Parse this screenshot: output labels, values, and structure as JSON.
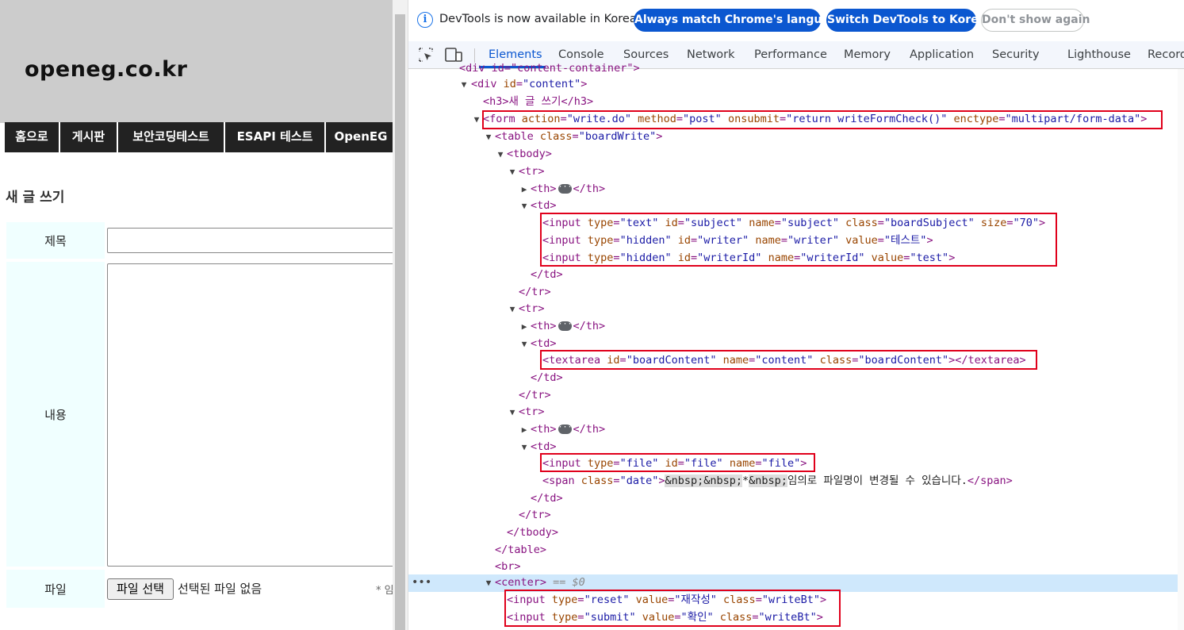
{
  "page": {
    "site_title": "openeg.co.kr",
    "nav": [
      "홈으로",
      "게시판",
      "보안코딩테스트",
      "ESAPI 테스트",
      "OpenEG"
    ],
    "heading": "새 글 쓰기",
    "labels": {
      "subject": "제목",
      "content": "내용",
      "file": "파일"
    },
    "file_button": "파일 선택",
    "no_file": "선택된 파일 없음",
    "date_note": "* 임"
  },
  "devtools": {
    "info_text": "DevTools is now available in Korean!",
    "btn_match": "Always match Chrome's language",
    "btn_korean": "Switch DevTools to Korean",
    "btn_dismiss": "Don't show again",
    "tabs": [
      "Elements",
      "Console",
      "Sources",
      "Network",
      "Performance",
      "Memory",
      "Application",
      "Security",
      "Lighthouse",
      "Record"
    ],
    "active_tab": "Elements",
    "selected_suffix": "== $0",
    "tree": {
      "l0": "<div id=\"content-container\">",
      "l1_tag": "<div ",
      "l1_an": "id",
      "l1_av": "\"content\"",
      "h3": "<h3>새 글 쓰기</h3>",
      "form_tag": "form ",
      "form_action": "action",
      "form_action_v": "\"write.do\"",
      "form_method": "method",
      "form_method_v": "\"post\"",
      "form_onsubmit": "onsubmit",
      "form_onsubmit_v": "\"return writeFormCheck()\"",
      "form_enctype": "enctype",
      "form_enctype_v": "\"multipart/form-data\"",
      "table_open": "<table ",
      "table_an": "class",
      "table_av": "\"boardWrite\"",
      "tbody": "<tbody>",
      "tr": "<tr>",
      "th_open": "<th>",
      "th_close": "</th>",
      "td": "<td>",
      "td_close": "</td>",
      "tr_close": "</tr>",
      "tbody_close": "</tbody>",
      "table_close": "</table>",
      "br": "<br>",
      "center": "<center>",
      "input1": {
        "type": "\"text\"",
        "id": "\"subject\"",
        "name": "\"subject\"",
        "class": "\"boardSubject\"",
        "size": "\"70\""
      },
      "input2": {
        "type": "\"hidden\"",
        "id": "\"writer\"",
        "name": "\"writer\"",
        "value": "\"테스트\""
      },
      "input3": {
        "type": "\"hidden\"",
        "id": "\"writerId\"",
        "name": "\"writerId\"",
        "value": "\"test\""
      },
      "textarea": {
        "id": "\"boardContent\"",
        "name": "\"content\"",
        "class": "\"boardContent\""
      },
      "file_input": {
        "type": "\"file\"",
        "id": "\"file\"",
        "name": "\"file\""
      },
      "span_class": "\"date\"",
      "span_nbsp1": "&nbsp;&nbsp;",
      "span_star": "*",
      "span_nbsp2": "&nbsp;",
      "span_text": "임의로 파일명이 변경될 수 있습니다.",
      "reset": {
        "type": "\"reset\"",
        "value": "\"재작성\"",
        "class": "\"writeBt\""
      },
      "submit": {
        "type": "\"submit\"",
        "value": "\"확인\"",
        "class": "\"writeBt\""
      }
    }
  },
  "colors": {
    "accent": "#0b57d0",
    "highlight_box": "#e0001b",
    "tag": "#881280",
    "attr_name": "#994500",
    "attr_value": "#1a1aa6"
  }
}
